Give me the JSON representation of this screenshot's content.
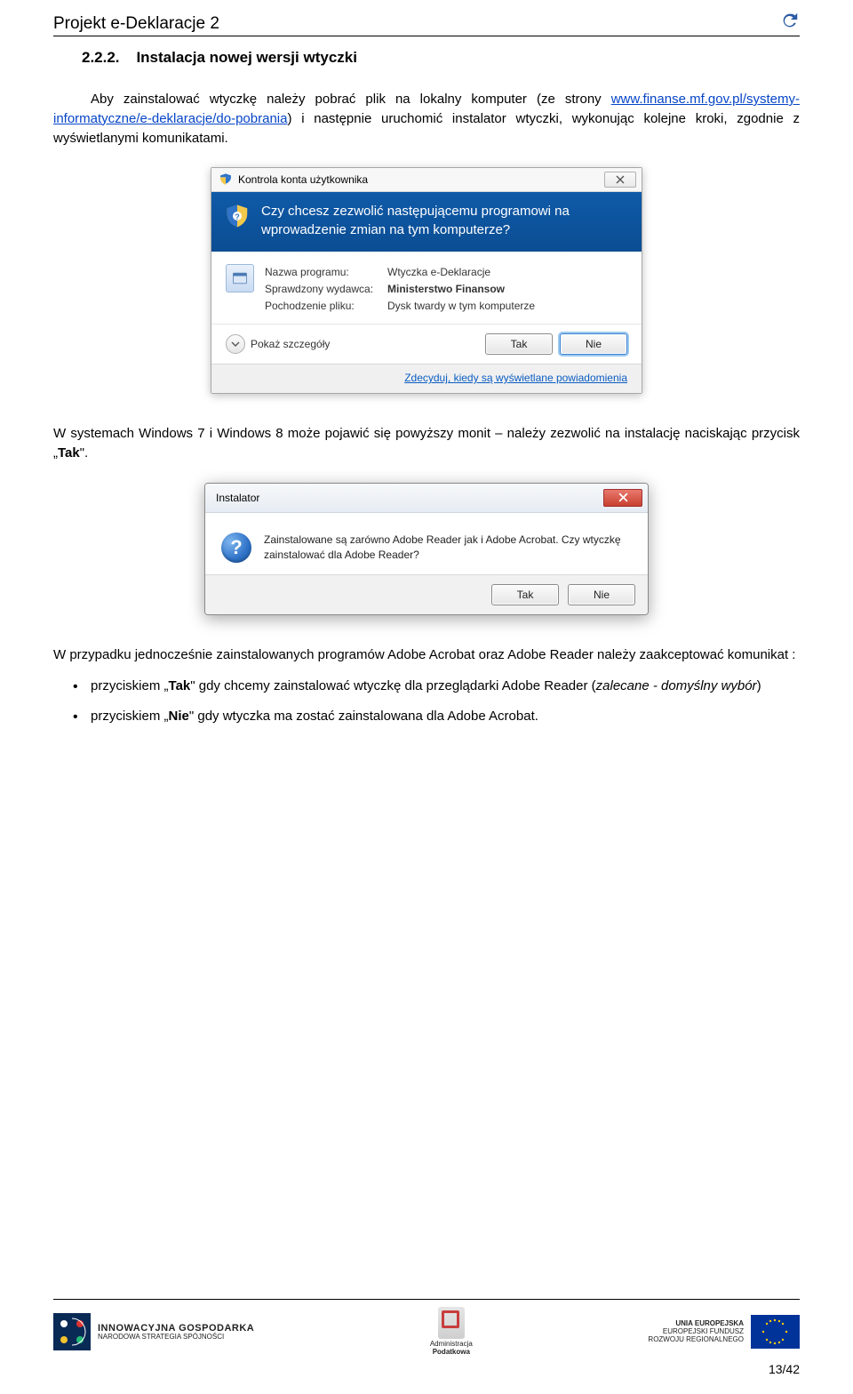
{
  "header": {
    "title": "Projekt e-Deklaracje 2"
  },
  "heading": {
    "number": "2.2.2.",
    "title": "Instalacja nowej wersji wtyczki"
  },
  "para1a": "Aby zainstalować wtyczkę należy pobrać plik na lokalny komputer (ze strony ",
  "para1_link": "www.finanse.mf.gov.pl/systemy-informatyczne/e-deklaracje/do-pobrania",
  "para1b": ") i następnie uruchomić instalator wtyczki, wykonując kolejne kroki, zgodnie z wyświetlanymi komunikatami.",
  "uac": {
    "title": "Kontrola konta użytkownika",
    "question": "Czy chcesz zezwolić następującemu programowi na wprowadzenie zmian na tym komputerze?",
    "labels": {
      "program": "Nazwa programu:",
      "publisher": "Sprawdzony wydawca:",
      "origin": "Pochodzenie pliku:"
    },
    "values": {
      "program": "Wtyczka e-Deklaracje",
      "publisher": "Ministerstwo Finansow",
      "origin": "Dysk twardy w tym komputerze"
    },
    "expand": "Pokaż szczegóły",
    "yes": "Tak",
    "no": "Nie",
    "footer_link": "Zdecyduj, kiedy są wyświetlane powiadomienia"
  },
  "para2a": "W systemach Windows 7 i Windows 8 może pojawić się powyższy monit – należy zezwolić na instalację naciskając przycisk „",
  "para2_tak": "Tak",
  "para2b": "\".",
  "inst": {
    "title": "Instalator",
    "message": "Zainstalowane są zarówno Adobe Reader jak i Adobe Acrobat. Czy wtyczkę zainstalować dla Adobe Reader?",
    "yes": "Tak",
    "no": "Nie"
  },
  "para3": "W przypadku jednocześnie zainstalowanych programów Adobe Acrobat oraz Adobe Reader należy zaakceptować komunikat :",
  "bullets": {
    "b1a": "przyciskiem „",
    "b1_tak": "Tak",
    "b1b": "\" gdy chcemy zainstalować wtyczkę dla przeglądarki Adobe Reader (",
    "b1_italic": "zalecane - domyślny wybór",
    "b1c": ")",
    "b2a": "przyciskiem „",
    "b2_nie": "Nie",
    "b2b": "\" gdy wtyczka ma zostać zainstalowana dla Adobe Acrobat."
  },
  "footer": {
    "logo1_big": "INNOWACYJNA GOSPODARKA",
    "logo1_small": "NARODOWA STRATEGIA SPÓJNOŚCI",
    "logo2a": "Administracja",
    "logo2b": "Podatkowa",
    "logo3a": "UNIA EUROPEJSKA",
    "logo3b": "EUROPEJSKI FUNDUSZ",
    "logo3c": "ROZWOJU REGIONALNEGO",
    "page": "13/42"
  }
}
